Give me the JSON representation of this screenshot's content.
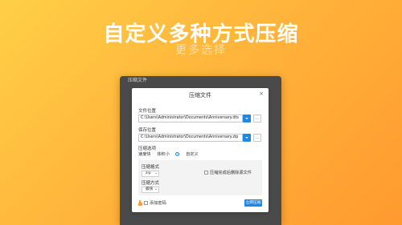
{
  "hero": {
    "title": "自定义多种方式压缩",
    "subtitle": "更多选择"
  },
  "app": {
    "window_title": "压缩文件"
  },
  "dialog": {
    "title": "压缩文件",
    "close_glyph": "×",
    "file_location_label": "文件位置",
    "file_location_value": "C:\\Users\\Administrator\\Documents\\Anniversary.dts",
    "save_location_label": "保存位置",
    "save_location_value": "C:\\Users\\Administrator\\Documents\\Anniversary.zip",
    "browse_glyph": "…",
    "compression_options_label": "压缩选项",
    "options": {
      "fast": "速度快",
      "small": "体积小",
      "custom": "自定义"
    },
    "custom": {
      "format_label": "压缩格式",
      "format_value": "zip",
      "method_label": "压缩方式",
      "method_value": "最快",
      "delete_after_label": "压缩完成后删除源文件"
    },
    "add_password_label": "添加密码",
    "start_button": "立即压缩"
  },
  "colors": {
    "accent": "#1e88e5",
    "background_start": "#ffcf47",
    "background_end": "#ff9a2f"
  }
}
